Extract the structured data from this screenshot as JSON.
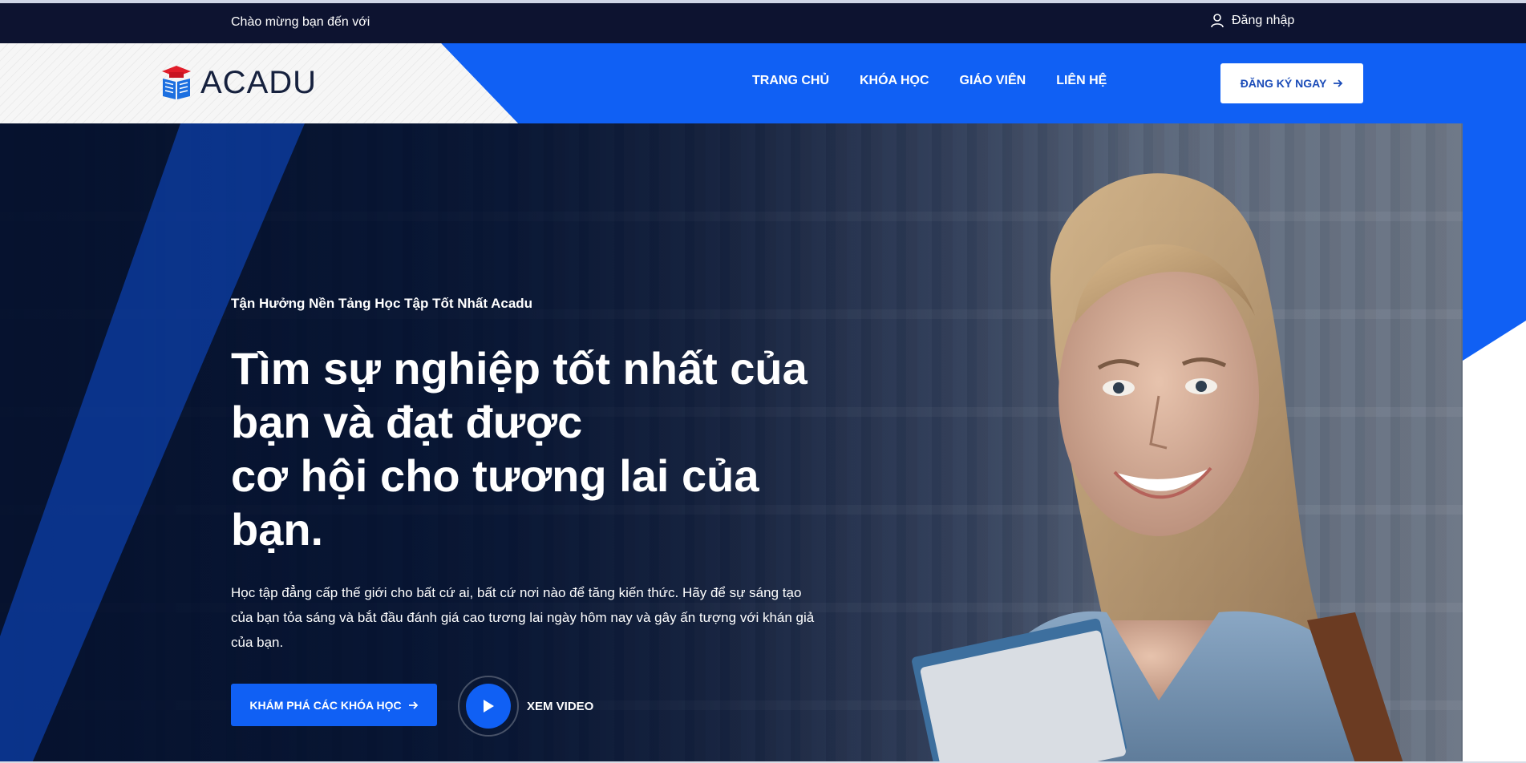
{
  "topbar": {
    "welcome": "Chào mừng bạn đến với",
    "login_label": "Đăng nhập",
    "login_icon": "user-icon"
  },
  "header": {
    "brand": "ACADU",
    "logo_icon": "graduation-book-icon",
    "nav": [
      {
        "label": "TRANG CHỦ"
      },
      {
        "label": "KHÓA HỌC"
      },
      {
        "label": "GIÁO VIÊN"
      },
      {
        "label": "LIÊN HỆ"
      }
    ],
    "cta_label": "ĐĂNG KÝ NGAY",
    "cta_icon": "arrow-right-icon"
  },
  "hero": {
    "eyebrow": "Tận Hưởng Nền Tảng Học Tập Tốt Nhất Acadu",
    "headline_line1": "Tìm sự nghiệp tốt nhất của bạn và đạt được",
    "headline_line2": "cơ hội cho tương lai của bạn.",
    "description": "Học tập đẳng cấp thế giới cho bất cứ ai, bất cứ nơi nào để tăng kiến thức. Hãy để sự sáng tạo của bạn tỏa sáng và bắt đầu đánh giá cao tương lai ngày hôm nay và gây ấn tượng với khán giả của bạn.",
    "explore_label": "KHÁM PHÁ CÁC KHÓA HỌC",
    "video_label": "XEM VIDEO",
    "play_icon": "play-icon"
  },
  "colors": {
    "primary": "#1060f4",
    "topbar": "#0d1330",
    "hero_dark": "#071533",
    "brand_text": "#16213e"
  }
}
